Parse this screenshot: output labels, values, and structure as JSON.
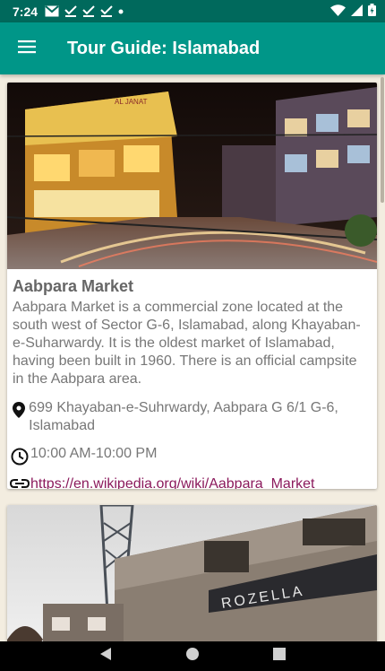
{
  "status_bar": {
    "time": "7:24",
    "icons": [
      "gmail-icon",
      "check-icon",
      "check-icon",
      "check-icon",
      "dot-icon",
      "wifi-icon",
      "signal-icon",
      "battery-icon"
    ]
  },
  "app_bar": {
    "title": "Tour Guide: Islamabad",
    "menu_icon": "hamburger-menu-icon",
    "color": "#009688",
    "status_color": "#00695c"
  },
  "places": [
    {
      "name": "Aabpara Market",
      "description": "Aabpara Market is a commercial zone located at the south west of Sector G-6, Islamabad, along Khayaban-e-Suharwardy. It is the oldest market of Islamabad, having been built in 1960. There is an official campsite in the Aabpara area.",
      "address": "699 Khayaban-e-Suhrwardy, Aabpara G 6/1 G-6, Islamabad",
      "hours": "10:00 AM-10:00 PM",
      "link": "https://en.wikipedia.org/wiki/Aabpara_Market",
      "image_sign": "AL JANAT"
    },
    {
      "image_sign": "ROZELLA"
    }
  ],
  "nav_bar": {
    "icons": [
      "back-icon",
      "home-icon",
      "recents-icon"
    ]
  },
  "colors": {
    "link": "#8b1a5c",
    "text": "#777777",
    "background": "#f3ede0"
  }
}
